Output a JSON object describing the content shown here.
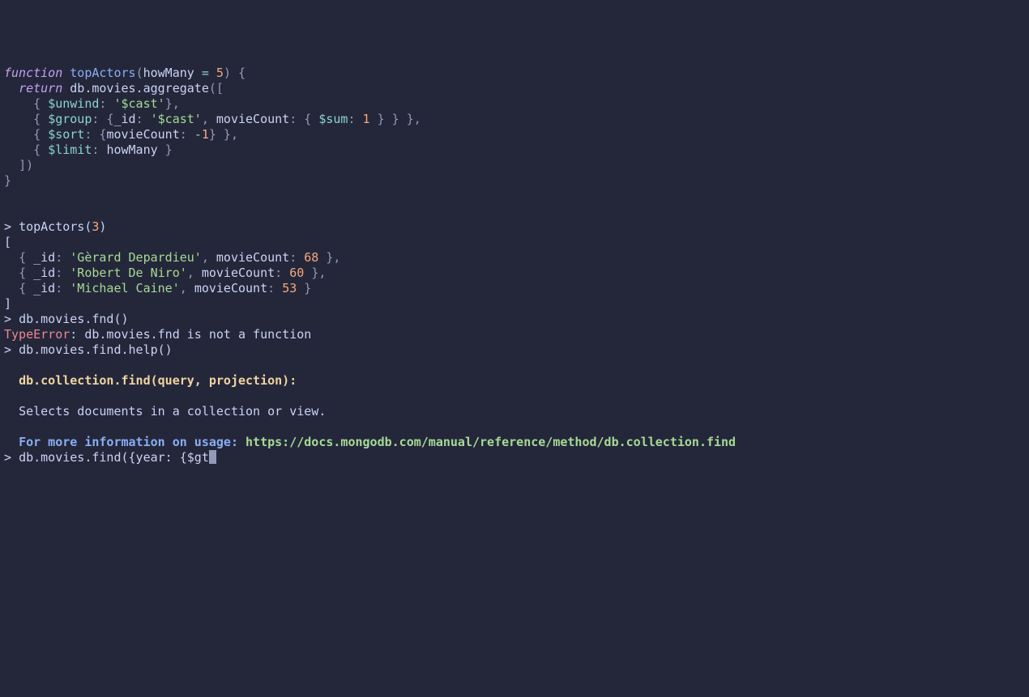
{
  "fn_def": {
    "keyword_function": "function",
    "name": "topActors",
    "param": "howMany",
    "default": "5",
    "keyword_return": "return",
    "db_call": "db.movies.aggregate",
    "unwind_key": "$unwind",
    "unwind_val": "'$cast'",
    "group_key": "$group",
    "id_key": "_id",
    "id_val": "'$cast'",
    "moviecount_key": "movieCount",
    "sum_key": "$sum",
    "sum_val": "1",
    "sort_key": "$sort",
    "sort_field": "movieCount",
    "sort_dir_op": "-",
    "sort_dir_num": "1",
    "limit_key": "$limit",
    "limit_val": "howMany"
  },
  "call": {
    "prompt": ">",
    "fn": "topActors",
    "arg": "3"
  },
  "results": [
    {
      "id": "'Gèrard Depardieu'",
      "count": "68"
    },
    {
      "id": "'Robert De Niro'",
      "count": "60"
    },
    {
      "id": "'Michael Caine'",
      "count": "53"
    }
  ],
  "result_keys": {
    "id": "_id",
    "mc": "movieCount"
  },
  "fnd_line": {
    "prompt": ">",
    "text": "db.movies.fnd()"
  },
  "error": {
    "type": "TypeError",
    "msg": ": db.movies.fnd is not a function"
  },
  "help_call": {
    "prompt": ">",
    "text": "db.movies.find.help()"
  },
  "help": {
    "sig": "db.collection.find(query, projection):",
    "desc": "Selects documents in a collection or view.",
    "more": "For more information on usage: ",
    "url": "https://docs.mongodb.com/manual/reference/method/db.collection.find"
  },
  "input": {
    "prompt": ">",
    "text": "db.movies.find({year: {$gt"
  }
}
